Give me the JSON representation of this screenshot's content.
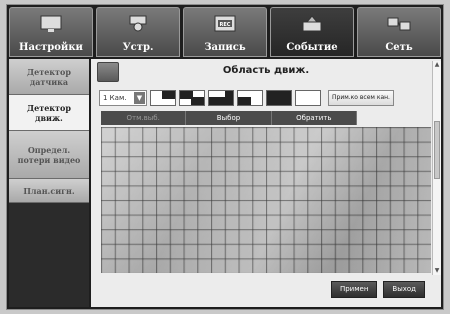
{
  "tabs": [
    {
      "label": "Настройки",
      "icon": "monitor-icon",
      "active": false
    },
    {
      "label": "Устр.",
      "icon": "camera-icon",
      "active": false
    },
    {
      "label": "Запись",
      "icon": "rec-icon",
      "active": false
    },
    {
      "label": "Событие",
      "icon": "event-icon",
      "active": true
    },
    {
      "label": "Сеть",
      "icon": "network-icon",
      "active": false
    }
  ],
  "sidebar": {
    "items": [
      {
        "label": "Детектор датчика"
      },
      {
        "label": "Детектор движ."
      },
      {
        "label": "Определ. потери видео"
      },
      {
        "label": "План.сигн."
      }
    ]
  },
  "main": {
    "title": "Область движ.",
    "camera_select": "1 Кам.",
    "apply_all_label": "Прим.ко всем кан.",
    "actions": [
      "Отм.выб.",
      "Выбор",
      "Обратить"
    ],
    "apply_label": "Примен",
    "exit_label": "Выход"
  },
  "colors": {
    "accent_dark": "#262626",
    "panel_bg": "#ececec"
  }
}
